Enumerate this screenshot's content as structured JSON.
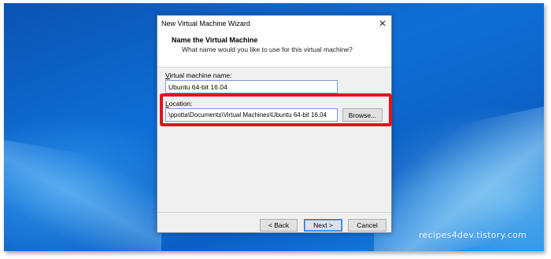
{
  "desktop": {
    "watermark": "recipes4dev.tistory.com"
  },
  "dialog": {
    "title": "New Virtual Machine Wizard",
    "close_glyph": "✕",
    "header_title": "Name the Virtual Machine",
    "header_subtitle": "What name would you like to use for this virtual machine?",
    "name_label_access": "V",
    "name_label_rest": "irtual machine name:",
    "name_value": "Ubuntu 64-bit 16.04",
    "location_label_access": "L",
    "location_label_rest": "ocation:",
    "location_value": ":\\ppotta\\Documents\\Virtual Machines\\Ubuntu 64-bit 16.04",
    "browse_label": "Browse...",
    "back_label": "< Back",
    "next_label": "Next >",
    "cancel_label": "Cancel"
  },
  "colors": {
    "highlight": "#e3141b",
    "desktop_blue": "#0f6fd6"
  }
}
